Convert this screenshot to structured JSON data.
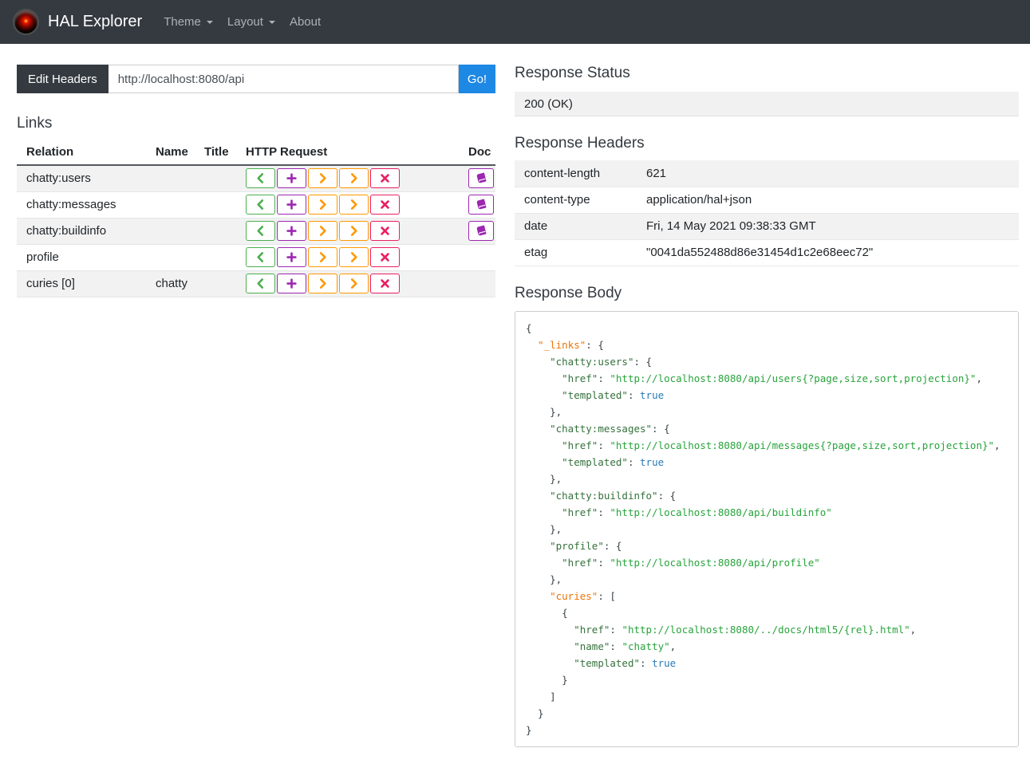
{
  "navbar": {
    "brand": "HAL Explorer",
    "items": [
      {
        "id": "theme",
        "label": "Theme",
        "caret": true
      },
      {
        "id": "layout",
        "label": "Layout",
        "caret": true
      },
      {
        "id": "about",
        "label": "About",
        "caret": false
      }
    ]
  },
  "url_bar": {
    "edit_headers_label": "Edit Headers",
    "url": "http://localhost:8080/api",
    "go_label": "Go!"
  },
  "links": {
    "title": "Links",
    "columns": [
      "Relation",
      "Name",
      "Title",
      "HTTP Request",
      "Doc"
    ],
    "request_buttons": [
      {
        "name": "http-get-button",
        "icon": "chevron-left-icon",
        "color": "#4caf50"
      },
      {
        "name": "http-post-button",
        "icon": "plus-icon",
        "color": "#9c27b0"
      },
      {
        "name": "http-put-button",
        "icon": "chevron-right-icon",
        "color": "#ff9800"
      },
      {
        "name": "http-patch-button",
        "icon": "chevron-right-icon",
        "color": "#ff9800"
      },
      {
        "name": "http-delete-button",
        "icon": "x-icon",
        "color": "#e91e63"
      }
    ],
    "doc_button": {
      "name": "doc-button",
      "icon": "book-icon",
      "color": "#9c27b0"
    },
    "rows": [
      {
        "relation": "chatty:users",
        "name": "",
        "title": "",
        "doc": true
      },
      {
        "relation": "chatty:messages",
        "name": "",
        "title": "",
        "doc": true
      },
      {
        "relation": "chatty:buildinfo",
        "name": "",
        "title": "",
        "doc": true
      },
      {
        "relation": "profile",
        "name": "",
        "title": "",
        "doc": false
      },
      {
        "relation": "curies [0]",
        "name": "chatty",
        "title": "",
        "doc": false
      }
    ]
  },
  "response_status": {
    "title": "Response Status",
    "value": "200 (OK)"
  },
  "response_headers": {
    "title": "Response Headers",
    "rows": [
      {
        "key": "content-length",
        "value": "621"
      },
      {
        "key": "content-type",
        "value": "application/hal+json"
      },
      {
        "key": "date",
        "value": "Fri, 14 May 2021 09:38:33 GMT"
      },
      {
        "key": "etag",
        "value": "\"0041da552488d86e31454d1c2e68eec72\""
      }
    ]
  },
  "response_body": {
    "title": "Response Body",
    "lines": [
      [
        [
          "p",
          "{"
        ]
      ],
      [
        [
          "p",
          "  "
        ],
        [
          "h",
          "\"_links\""
        ],
        [
          "p",
          ": {"
        ]
      ],
      [
        [
          "p",
          "    "
        ],
        [
          "k",
          "\"chatty:users\""
        ],
        [
          "p",
          ": {"
        ]
      ],
      [
        [
          "p",
          "      "
        ],
        [
          "k",
          "\"href\""
        ],
        [
          "p",
          ": "
        ],
        [
          "s",
          "\"http://localhost:8080/api/users{?page,size,sort,projection}\""
        ],
        [
          "p",
          ","
        ]
      ],
      [
        [
          "p",
          "      "
        ],
        [
          "k",
          "\"templated\""
        ],
        [
          "p",
          ": "
        ],
        [
          "b",
          "true"
        ]
      ],
      [
        [
          "p",
          "    },"
        ]
      ],
      [
        [
          "p",
          "    "
        ],
        [
          "k",
          "\"chatty:messages\""
        ],
        [
          "p",
          ": {"
        ]
      ],
      [
        [
          "p",
          "      "
        ],
        [
          "k",
          "\"href\""
        ],
        [
          "p",
          ": "
        ],
        [
          "s",
          "\"http://localhost:8080/api/messages{?page,size,sort,projection}\""
        ],
        [
          "p",
          ","
        ]
      ],
      [
        [
          "p",
          "      "
        ],
        [
          "k",
          "\"templated\""
        ],
        [
          "p",
          ": "
        ],
        [
          "b",
          "true"
        ]
      ],
      [
        [
          "p",
          "    },"
        ]
      ],
      [
        [
          "p",
          "    "
        ],
        [
          "k",
          "\"chatty:buildinfo\""
        ],
        [
          "p",
          ": {"
        ]
      ],
      [
        [
          "p",
          "      "
        ],
        [
          "k",
          "\"href\""
        ],
        [
          "p",
          ": "
        ],
        [
          "s",
          "\"http://localhost:8080/api/buildinfo\""
        ]
      ],
      [
        [
          "p",
          "    },"
        ]
      ],
      [
        [
          "p",
          "    "
        ],
        [
          "k",
          "\"profile\""
        ],
        [
          "p",
          ": {"
        ]
      ],
      [
        [
          "p",
          "      "
        ],
        [
          "k",
          "\"href\""
        ],
        [
          "p",
          ": "
        ],
        [
          "s",
          "\"http://localhost:8080/api/profile\""
        ]
      ],
      [
        [
          "p",
          "    },"
        ]
      ],
      [
        [
          "p",
          "    "
        ],
        [
          "h",
          "\"curies\""
        ],
        [
          "p",
          ": ["
        ]
      ],
      [
        [
          "p",
          "      {"
        ]
      ],
      [
        [
          "p",
          "        "
        ],
        [
          "k",
          "\"href\""
        ],
        [
          "p",
          ": "
        ],
        [
          "s",
          "\"http://localhost:8080/../docs/html5/{rel}.html\""
        ],
        [
          "p",
          ","
        ]
      ],
      [
        [
          "p",
          "        "
        ],
        [
          "k",
          "\"name\""
        ],
        [
          "p",
          ": "
        ],
        [
          "s",
          "\"chatty\""
        ],
        [
          "p",
          ","
        ]
      ],
      [
        [
          "p",
          "        "
        ],
        [
          "k",
          "\"templated\""
        ],
        [
          "p",
          ": "
        ],
        [
          "b",
          "true"
        ]
      ],
      [
        [
          "p",
          "      }"
        ]
      ],
      [
        [
          "p",
          "    ]"
        ]
      ],
      [
        [
          "p",
          "  }"
        ]
      ],
      [
        [
          "p",
          "}"
        ]
      ]
    ]
  },
  "colors": {
    "navbar_bg": "#343a40",
    "primary_blue": "#1e88e5",
    "get_green": "#4caf50",
    "post_purple": "#9c27b0",
    "put_patch_orange": "#ff9800",
    "delete_pink": "#e91e63",
    "json_special_key": "#ed7404",
    "json_key": "#35713c",
    "json_string": "#28a33c",
    "json_boolean": "#2a7ab5"
  }
}
